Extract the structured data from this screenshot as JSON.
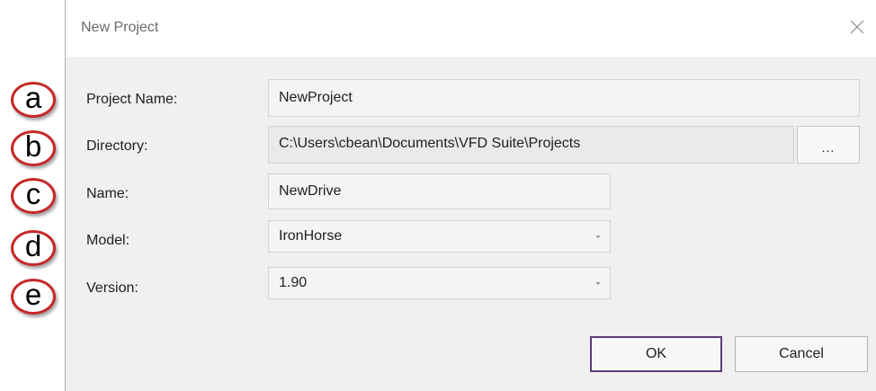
{
  "callouts": [
    "a",
    "b",
    "c",
    "d",
    "e"
  ],
  "dialog": {
    "title": "New Project",
    "close_icon": "close-icon"
  },
  "form": {
    "project_name": {
      "label": "Project Name:",
      "value": "NewProject"
    },
    "directory": {
      "label": "Directory:",
      "value": "C:\\Users\\cbean\\Documents\\VFD Suite\\Projects",
      "browse_label": "..."
    },
    "name": {
      "label": "Name:",
      "value": "NewDrive"
    },
    "model": {
      "label": "Model:",
      "value": "IronHorse"
    },
    "version": {
      "label": "Version:",
      "value": "1.90"
    }
  },
  "buttons": {
    "ok": "OK",
    "cancel": "Cancel"
  },
  "colors": {
    "callout_border": "#c62828",
    "ok_border": "#5b3d78",
    "dialog_bg": "#f0f0f0"
  }
}
